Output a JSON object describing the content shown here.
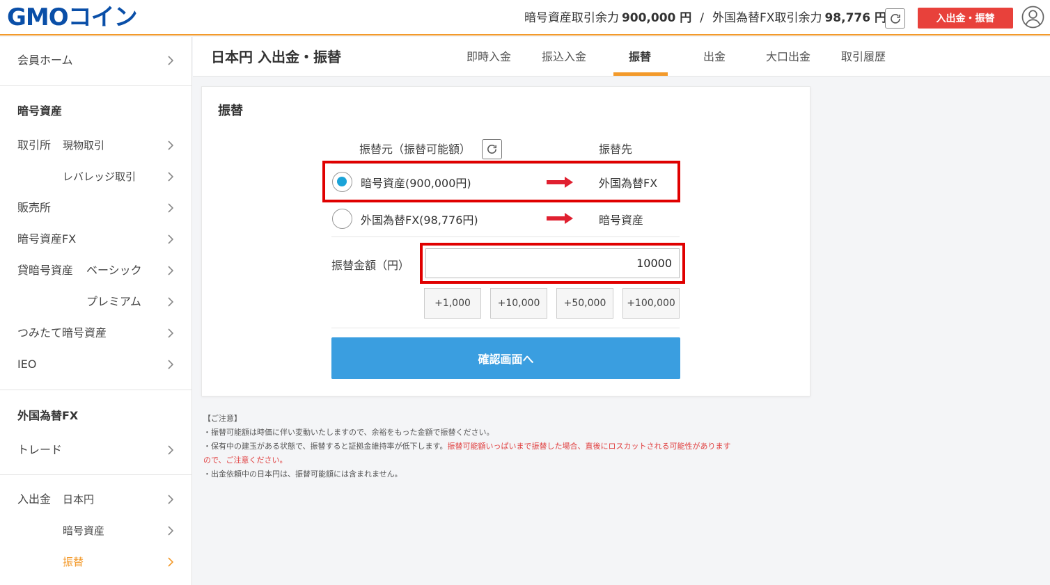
{
  "header": {
    "logo": "GMOコイン",
    "crypto_balance_label": "暗号資産取引余力",
    "crypto_balance_value": "900,000 円",
    "separator": "/",
    "fx_balance_label": "外国為替FX取引余力",
    "fx_balance_value": "98,776 円",
    "deposit_button": "入出金・振替"
  },
  "sidebar": {
    "home": "会員ホーム",
    "crypto_heading": "暗号資産",
    "exchange": "取引所",
    "spot": "現物取引",
    "leverage": "レバレッジ取引",
    "dealer": "販売所",
    "crypto_fx": "暗号資産FX",
    "lending": "貸暗号資産",
    "basic": "ベーシック",
    "premium": "プレミアム",
    "tsumitate": "つみたて暗号資産",
    "ieo": "IEO",
    "fx_heading": "外国為替FX",
    "trade": "トレード",
    "deposit": "入出金",
    "jpy": "日本円",
    "crypto_asset": "暗号資産",
    "transfer": "振替"
  },
  "titlebar": {
    "title": "日本円 入出金・振替",
    "tabs": [
      "即時入金",
      "振込入金",
      "振替",
      "出金",
      "大口出金",
      "取引履歴"
    ]
  },
  "card": {
    "title": "振替",
    "source_header": "振替元（振替可能額）",
    "dest_header": "振替先",
    "options": [
      {
        "label": "暗号資産(900,000円)",
        "dest": "外国為替FX"
      },
      {
        "label": "外国為替FX(98,776円)",
        "dest": "暗号資産"
      }
    ],
    "amount_label": "振替金額（円）",
    "amount_value": "10000",
    "quick_buttons": [
      "+1,000",
      "+10,000",
      "+50,000",
      "+100,000"
    ],
    "confirm_button": "確認画面へ"
  },
  "notes": {
    "heading": "【ご注意】",
    "line1": "・振替可能額は時価に伴い変動いたしますので、余裕をもった金額で振替ください。",
    "line2a": "・保有中の建玉がある状態で、振替すると証拠金維持率が低下します。",
    "line2b": "振替可能額いっぱいまで振替した場合、直後にロスカットされる可能性があります",
    "line2c": "ので、ご注意ください。",
    "line3": "・出金依頼中の日本円は、振替可能額には含まれません。"
  },
  "colors": {
    "accent_orange": "#f39a2b",
    "deposit_red": "#e8413b",
    "confirm_blue": "#3a9ee0",
    "highlight_red": "#e00000",
    "radio_cyan": "#1aa3d8",
    "logo_blue": "#0a4fa8"
  }
}
